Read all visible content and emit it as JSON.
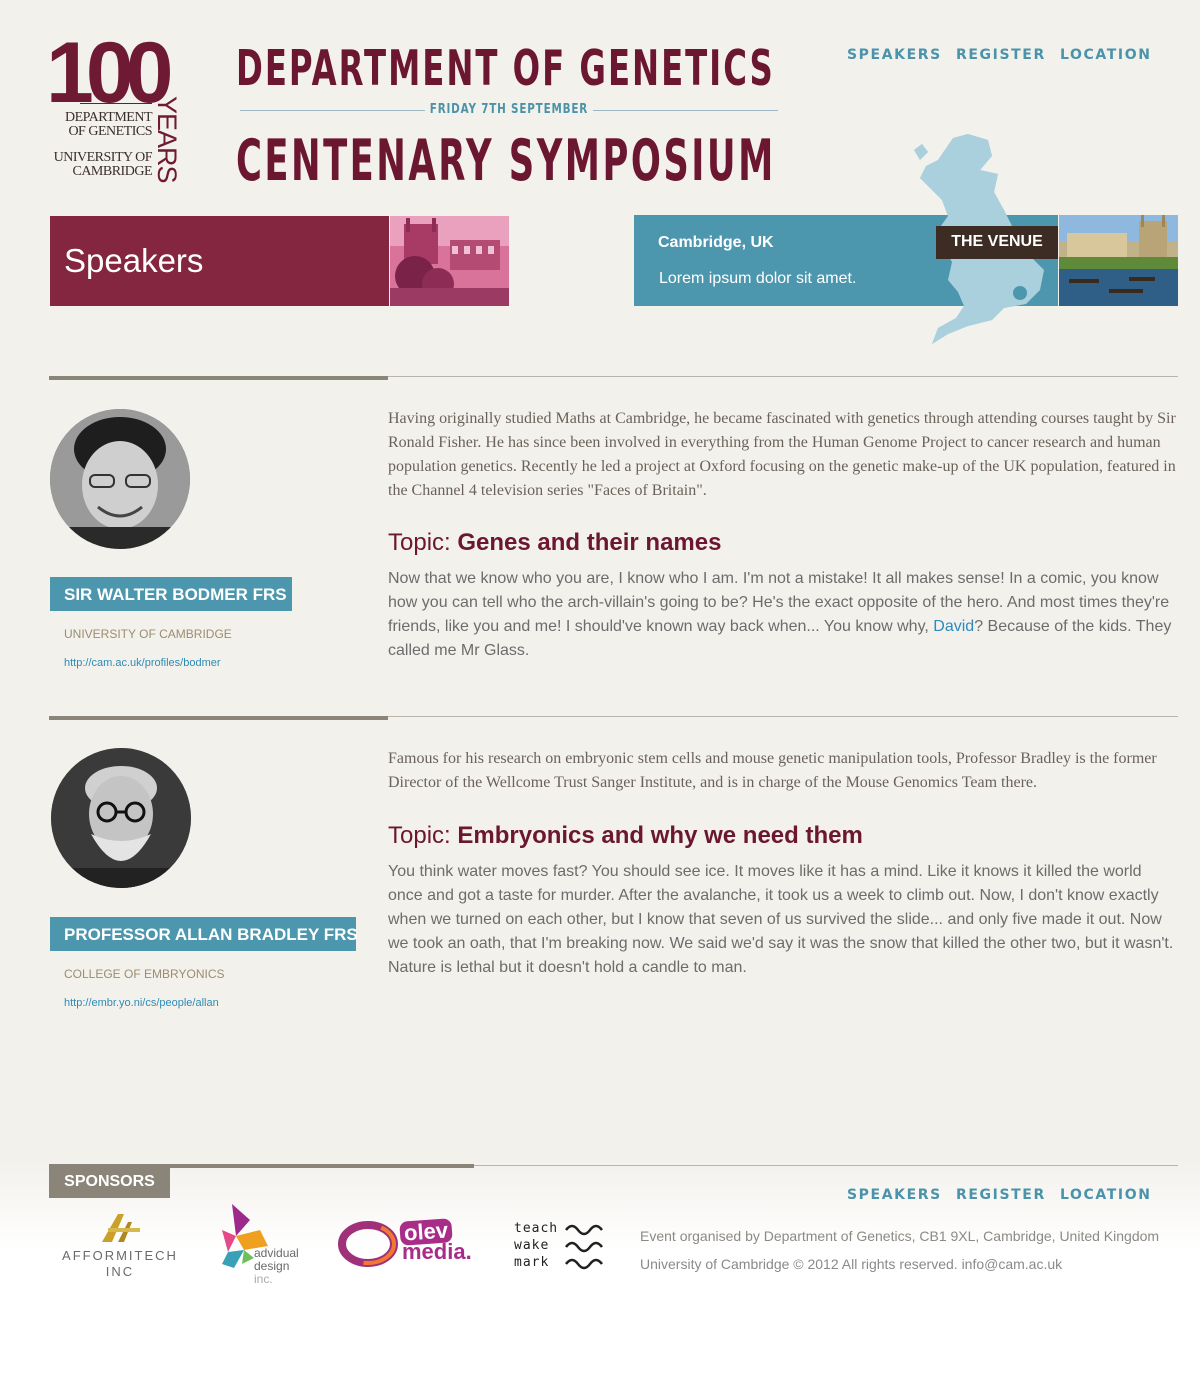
{
  "logo": {
    "number": "100",
    "years": "YEARS",
    "dept_line1": "DEPARTMENT",
    "dept_line2": "OF GENETICS",
    "uni_line1": "UNIVERSITY OF",
    "uni_line2": "CAMBRIDGE"
  },
  "header": {
    "title_line1": "DEPARTMENT OF GENETICS",
    "date": "FRIDAY 7TH SEPTEMBER",
    "title_line2": "CENTENARY SYMPOSIUM"
  },
  "nav": {
    "speakers": "SPEAKERS",
    "register": "REGISTER",
    "location": "LOCATION"
  },
  "banner": {
    "speakers_title": "Speakers"
  },
  "venue": {
    "city": "Cambridge, UK",
    "description": "Lorem ipsum dolor sit amet.",
    "tag": "THE VENUE"
  },
  "speakers": [
    {
      "name": "SIR WALTER BODMER FRS",
      "affiliation": "UNIVERSITY OF CAMBRIDGE",
      "url": "http://cam.ac.uk/profiles/bodmer",
      "bio": "Having originally studied Maths at Cambridge, he became fascinated with genetics through attending courses taught by Sir Ronald Fisher. He has since been involved in everything from the Human Genome Project to cancer research and human population genetics. Recently he led a project at Oxford focusing on the genetic make-up of the UK population, featured in the Channel 4 television series \"Faces of Britain\".",
      "topic_prefix": "Topic: ",
      "topic": "Genes and their names",
      "body_before_link": "Now that we know who you are, I know who I am. I'm not a mistake! It all makes sense! In a comic, you know how you can tell who the arch-villain's going to be? He's the exact opposite of the hero. And most times they're friends, like you and me! I should've known way back when... You know why, ",
      "body_link": "David",
      "body_after_link": "? Because of the kids. They called me Mr Glass."
    },
    {
      "name": "PROFESSOR ALLAN BRADLEY FRS",
      "affiliation": "COLLEGE OF EMBRYONICS",
      "url": "http://embr.yo.ni/cs/people/allan",
      "bio": "Famous for his research on embryonic stem cells and mouse genetic manipulation tools, Professor Bradley is the former Director of the Wellcome Trust Sanger Institute, and is in charge of the Mouse Genomics Team there.",
      "topic_prefix": "Topic: ",
      "topic": "Embryonics and why we need them",
      "body": "You think water moves fast? You should see ice. It moves like it has a mind. Like it knows it killed the world once and got a taste for murder. After the avalanche, it took us a week to climb out. Now, I don't know exactly when we turned on each other, but I know that seven of us survived the slide... and only five made it out. Now we took an oath, that I'm breaking now. We said we'd say it was the snow that killed the other two, but it wasn't. Nature is lethal but it doesn't hold a candle to man."
    }
  ],
  "footer": {
    "sponsors_label": "SPONSORS",
    "sponsors": [
      {
        "name_line1": "AFFORMITECH",
        "name_line2": "INC"
      },
      {
        "name_line1": "advidual",
        "name_line2": "design",
        "name_line3": "inc."
      },
      {
        "name_line1": "olev",
        "name_line2": "media."
      },
      {
        "line1": "teach",
        "line2": "wake",
        "line3": "mark"
      }
    ],
    "organised_by": "Event organised by Department of Genetics, CB1 9XL, Cambridge, United Kingdom",
    "copyright": "University of Cambridge © 2012 All rights reserved. info@cam.ac.uk"
  },
  "colors": {
    "maroon": "#84263f",
    "teal": "#4c97ae",
    "dark_brown": "#3d2c24",
    "grey": "#8b8479",
    "link": "#2b8bc0"
  }
}
